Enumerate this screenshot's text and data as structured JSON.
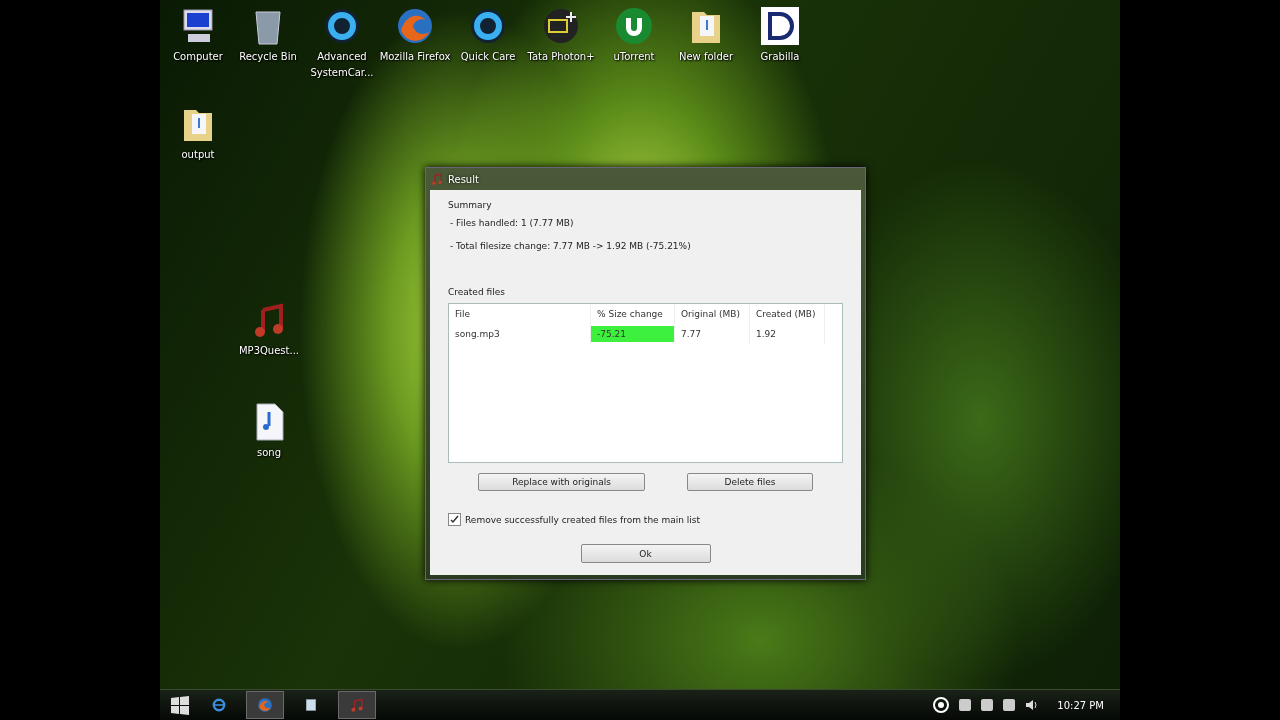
{
  "desktop_icons": [
    {
      "label": "Computer",
      "kind": "computer"
    },
    {
      "label": "Recycle Bin",
      "kind": "bin"
    },
    {
      "label": "Advanced SystemCar...",
      "kind": "ring"
    },
    {
      "label": "Mozilla Firefox",
      "kind": "globe"
    },
    {
      "label": "Quick Care",
      "kind": "ring"
    },
    {
      "label": "Tata Photon+",
      "kind": "modem"
    },
    {
      "label": "uTorrent",
      "kind": "torrent"
    },
    {
      "label": "New folder",
      "kind": "folder"
    },
    {
      "label": "Grabilla",
      "kind": "letter"
    },
    {
      "label": "output",
      "kind": "folder"
    },
    {
      "label": "MP3Quest...",
      "kind": "music"
    },
    {
      "label": "song",
      "kind": "file"
    }
  ],
  "dialog": {
    "title": "Result",
    "summary": {
      "heading": "Summary",
      "lines": [
        "- Files handled: 1  (7.77 MB)",
        "- Total filesize change: 7.77 MB -> 1.92 MB  (-75.21%)"
      ]
    },
    "created_files": {
      "heading": "Created files",
      "columns": [
        "File",
        "% Size change",
        "Original  (MB)",
        "Created  (MB)"
      ],
      "rows": [
        {
          "file": "song.mp3",
          "size_change": "-75.21",
          "color": "#3ef03e",
          "original": "7.77",
          "created": "1.92"
        }
      ]
    },
    "actions": [
      "Replace with originals",
      "Delete files"
    ],
    "remove_option": {
      "label": "Remove successfully created files from the main list",
      "checked": true
    },
    "ok": "Ok"
  },
  "taskbar": {
    "items": [
      {
        "kind": "browser-e",
        "running": false
      },
      {
        "kind": "globe",
        "running": true
      },
      {
        "kind": "window",
        "running": false
      },
      {
        "kind": "music",
        "running": true
      }
    ],
    "clock": "10:27 PM"
  }
}
